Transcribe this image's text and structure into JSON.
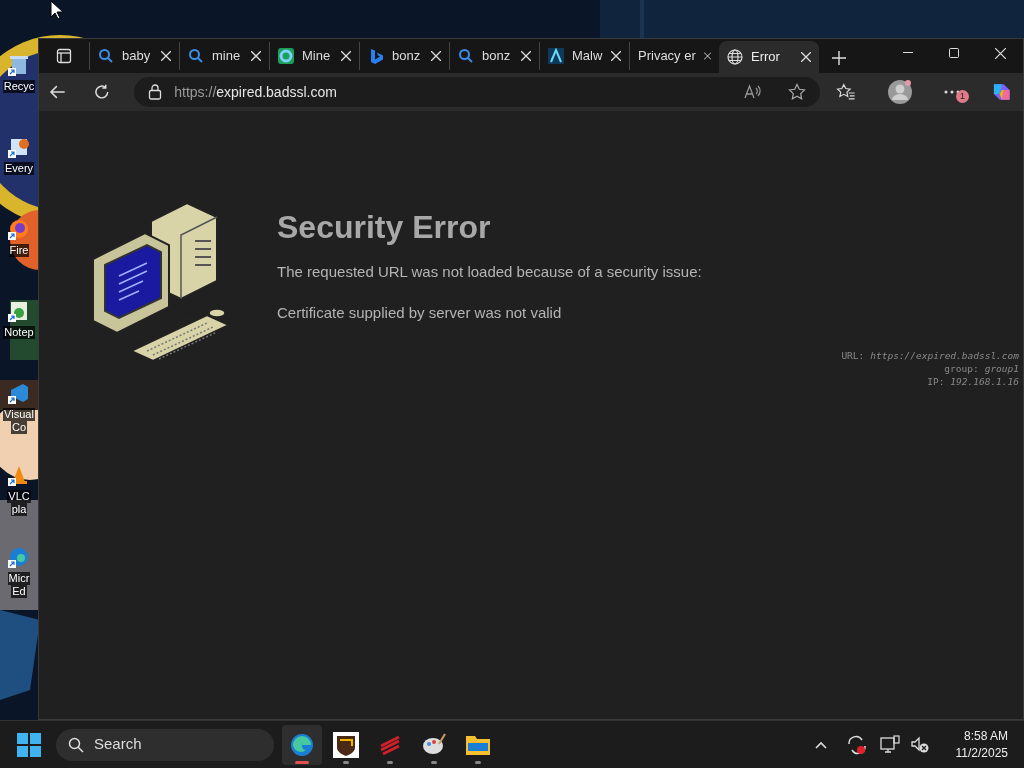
{
  "desktop": {
    "icons": [
      {
        "label": "Recyc",
        "kind": "bin"
      },
      {
        "label": "Every",
        "kind": "app"
      },
      {
        "label": "Fire",
        "kind": "fox"
      },
      {
        "label": "Notep",
        "kind": "notepad"
      },
      {
        "label": "Visual",
        "label_2": "Co",
        "kind": "code"
      },
      {
        "label": "VLC",
        "label_2": "pla",
        "kind": "cone"
      },
      {
        "label": "Micr",
        "label_2": "Ed",
        "kind": "edge"
      }
    ]
  },
  "browser": {
    "tabs": [
      {
        "title": "baby",
        "kind": "search",
        "selected": false
      },
      {
        "title": "mine",
        "kind": "search",
        "selected": false
      },
      {
        "title": "Mine",
        "kind": "ring",
        "selected": false
      },
      {
        "title": "bonz",
        "kind": "bing",
        "selected": false
      },
      {
        "title": "bonz",
        "kind": "search",
        "selected": false
      },
      {
        "title": "Malw",
        "kind": "peak",
        "selected": false
      },
      {
        "title": "Privacy er",
        "kind": "plain",
        "selected": false
      },
      {
        "title": "Error",
        "kind": "globe",
        "selected": true
      }
    ],
    "url_scheme": "https://",
    "url_host": "expired.badssl.com",
    "menu_badge": "1"
  },
  "page": {
    "title": "Security Error",
    "message": "The requested URL was not loaded because of a security issue:",
    "detail": "Certificate supplied by server was not valid",
    "info": [
      {
        "label": "URL:",
        "value": "https://expired.badssl.com"
      },
      {
        "label": "group:",
        "value": "group1"
      },
      {
        "label": "IP:",
        "value": "192.168.1.16"
      }
    ]
  },
  "taskbar": {
    "search_placeholder": "Search",
    "apps": [
      {
        "kind": "edge",
        "selected": true
      },
      {
        "kind": "shield",
        "selected": false
      },
      {
        "kind": "stripes",
        "selected": false
      },
      {
        "kind": "palette",
        "selected": false
      },
      {
        "kind": "folder",
        "selected": false
      }
    ],
    "time": "8:58 AM",
    "date": "11/2/2025"
  }
}
